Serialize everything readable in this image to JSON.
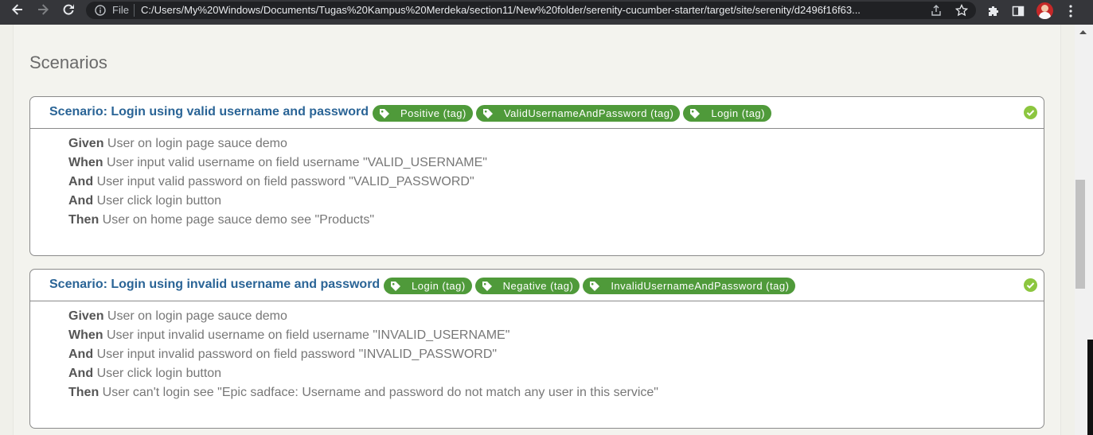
{
  "browser": {
    "file_label": "File",
    "url": "C:/Users/My%20Windows/Documents/Tugas%20Kampus%20Merdeka/section11/New%20folder/serenity-cucumber-starter/target/site/serenity/d2496f16f63...",
    "colors": {
      "toolbar": "#35363a",
      "omnibox": "#202124"
    }
  },
  "page": {
    "section_title": "Scenarios",
    "scenarios": [
      {
        "title": "Scenario: Login using valid username and password",
        "status": "passed",
        "tags": [
          "Positive (tag)",
          "ValidUsernameAndPassword (tag)",
          "Login (tag)"
        ],
        "steps": [
          {
            "keyword": "Given",
            "text": "User on login page sauce demo"
          },
          {
            "keyword": "When",
            "text": "User input valid username on field username \"VALID_USERNAME\""
          },
          {
            "keyword": "And",
            "text": "User input valid password on field password \"VALID_PASSWORD\""
          },
          {
            "keyword": "And",
            "text": "User click login button"
          },
          {
            "keyword": "Then",
            "text": "User on home page sauce demo see \"Products\""
          }
        ]
      },
      {
        "title": "Scenario: Login using invalid username and password",
        "status": "passed",
        "tags": [
          "Login (tag)",
          "Negative (tag)",
          "InvalidUsernameAndPassword (tag)"
        ],
        "steps": [
          {
            "keyword": "Given",
            "text": "User on login page sauce demo"
          },
          {
            "keyword": "When",
            "text": "User input invalid username on field username \"INVALID_USERNAME\""
          },
          {
            "keyword": "And",
            "text": "User input invalid password on field password \"INVALID_PASSWORD\""
          },
          {
            "keyword": "And",
            "text": "User click login button"
          },
          {
            "keyword": "Then",
            "text": "User can't login see \"Epic sadface: Username and password do not match any user in this service\""
          }
        ]
      }
    ],
    "colors": {
      "tag": "#4f9a3a",
      "title": "#2a6496",
      "pass": "#8cc63f"
    }
  }
}
